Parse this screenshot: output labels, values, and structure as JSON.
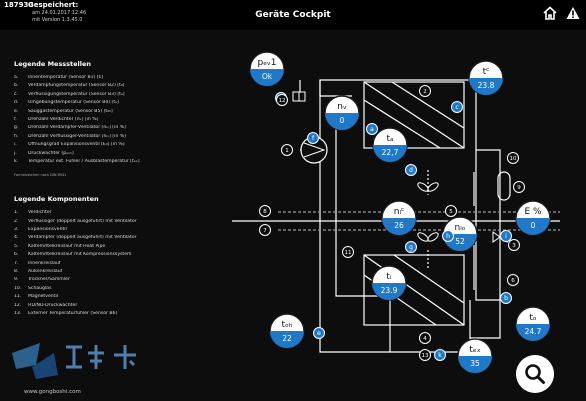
{
  "header": {
    "id": "187930",
    "saved_label": "Gespeichert:",
    "date": "am 24.01.2017 12:46",
    "version": "mit Version 1.3.45.0",
    "title": "Geräte Cockpit"
  },
  "icons": {
    "home": "home-icon",
    "warning": "warning-icon",
    "search": "search-icon"
  },
  "colors": {
    "accent": "#1f78c8",
    "background": "#0d0d0d",
    "line": "#ffffff"
  },
  "legend": {
    "measure_title": "Legende Messstellen",
    "measure_items": [
      {
        "n": "a.",
        "text": "Innentemperatur (Sensor B1) [tᵢ]"
      },
      {
        "n": "b.",
        "text": "Verdampfungstemperatur (Sensor B2) [t₀]"
      },
      {
        "n": "c.",
        "text": "Verflüssigungstemperatur (Sensor B3) [tₐ]"
      },
      {
        "n": "d.",
        "text": "Umgebungstemperatur (Sensor B4) [tₐ]"
      },
      {
        "n": "e.",
        "text": "Sauggastemperatur (Sensor B5) [t₀ₕ]"
      },
      {
        "n": "f.",
        "text": "Drehzahl Verdichter [nᵥ] [in %]"
      },
      {
        "n": "g.",
        "text": "Drehzahl Verdampfer-Ventilator [nᵢᵥ] [in %]"
      },
      {
        "n": "h.",
        "text": "Drehzahl Verflüssiger-Ventilator [nᵢᵥ] [in %]"
      },
      {
        "n": "i.",
        "text": "Öffnungsgrad Expansionsventil [E₀] [in %]"
      },
      {
        "n": "j.",
        "text": "Druckwächter [pₑᵥ₁]"
      },
      {
        "n": "k.",
        "text": "Temperatur ext. Fühler / Ausblastemperatur [tₑₓ]"
      }
    ],
    "measure_footnote": "Formelzeichen nach DIN 8941",
    "component_title": "Legende Komponenten",
    "component_items": [
      {
        "n": "1.",
        "text": "Verdichter"
      },
      {
        "n": "2.",
        "text": "Verflüssiger (doppelt ausgeführt) mit Ventilator"
      },
      {
        "n": "3.",
        "text": "Expansionsventil"
      },
      {
        "n": "4.",
        "text": "Verdampfer (doppelt ausgeführt) mit Ventilator"
      },
      {
        "n": "5.",
        "text": "Kältemittelkreislauf mit Heat Pipe"
      },
      {
        "n": "6.",
        "text": "Kältemittelkreislauf mit Kompressionssystem"
      },
      {
        "n": "7.",
        "text": "Innenkreislauf"
      },
      {
        "n": "8.",
        "text": "Außenkreislauf"
      },
      {
        "n": "9.",
        "text": "Trockner/Sammler"
      },
      {
        "n": "10.",
        "text": "Schauglas"
      },
      {
        "n": "11.",
        "text": "Magnetventil"
      },
      {
        "n": "12.",
        "text": "HD/ND-Druckwächter"
      },
      {
        "n": "13.",
        "text": "Externer Temperaturfühler (Sensor B6)"
      }
    ]
  },
  "gauges": {
    "pev1": {
      "label": "pₑᵥ1",
      "value": "Ok"
    },
    "nv": {
      "label": "nᵥ",
      "value": "0"
    },
    "tc": {
      "label": "tᶜ",
      "value": "23.8"
    },
    "ta": {
      "label": "tₐ",
      "value": "22,7"
    },
    "nlc": {
      "label": "nₗᶜ",
      "value": "26"
    },
    "nlo": {
      "label": "nₗₒ",
      "value": "52"
    },
    "epct": {
      "label": "E %",
      "value": "0"
    },
    "ti": {
      "label": "tᵢ",
      "value": "23.9"
    },
    "toh": {
      "label": "tₒₕ",
      "value": "22"
    },
    "to": {
      "label": "tₒ",
      "value": "24.7"
    },
    "tex": {
      "label": "tₑₓ",
      "value": "35"
    }
  },
  "markers": {
    "letters": [
      "a",
      "b",
      "c",
      "d",
      "e",
      "f",
      "g",
      "h",
      "i",
      "j",
      "k"
    ],
    "numbers": [
      "1",
      "2",
      "3",
      "4",
      "5",
      "6",
      "7",
      "8",
      "9",
      "10",
      "11",
      "12",
      "13"
    ]
  },
  "watermark": "www.gongboshi.com"
}
